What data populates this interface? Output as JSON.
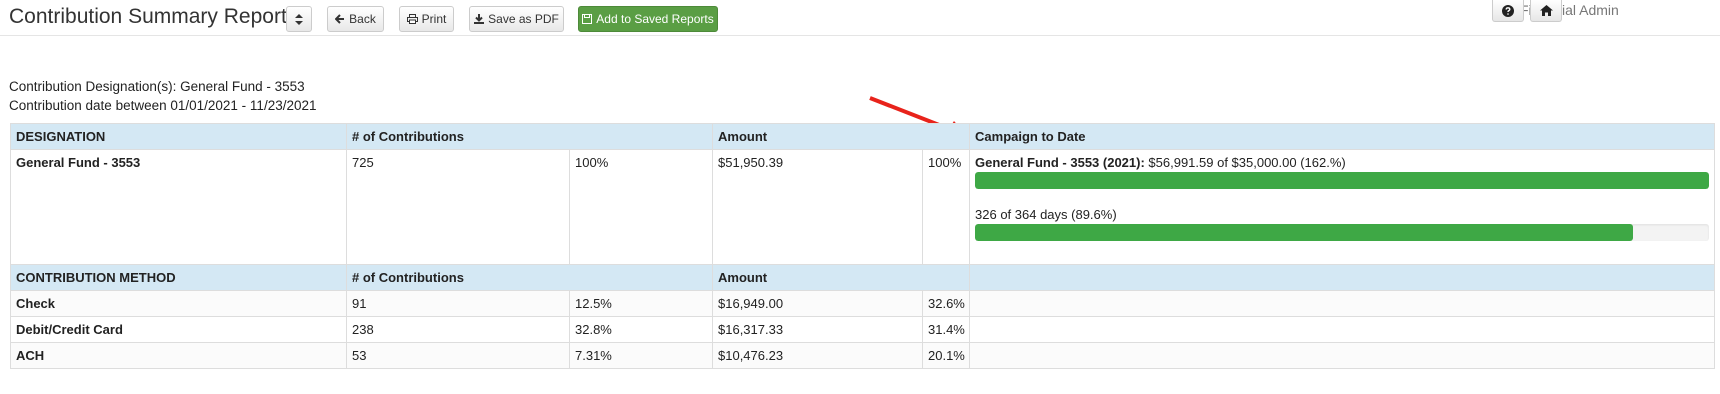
{
  "header": {
    "title": "Contribution Summary Report",
    "back_label": "Back",
    "print_label": "Print",
    "pdf_label": "Save as PDF",
    "saved_label": "Add to Saved Reports",
    "user": "Financial Admin"
  },
  "criteria": {
    "designation": "Contribution Designation(s): General Fund - 3553",
    "date_range": "Contribution date between 01/01/2021 - 11/23/2021"
  },
  "designation_table": {
    "headers": [
      "DESIGNATION",
      "# of Contributions",
      "Amount",
      "Campaign to Date"
    ],
    "row": {
      "name": "General Fund - 3553",
      "count": "725",
      "count_pct": "100%",
      "amount": "$51,950.39",
      "amount_pct": "100%",
      "campaign_name": "General Fund - 3553 (2021):",
      "campaign_text": " $56,991.59 of $35,000.00 (162.%)",
      "campaign_progress": 1.0,
      "days_text": "326 of 364 days (89.6%)",
      "days_progress": 0.896
    }
  },
  "method_table": {
    "headers": [
      "CONTRIBUTION METHOD",
      "# of Contributions",
      "Amount"
    ],
    "rows": [
      {
        "method": "Check",
        "count": "91",
        "count_pct": "12.5%",
        "amount": "$16,949.00",
        "amount_pct": "32.6%"
      },
      {
        "method": "Debit/Credit Card",
        "count": "238",
        "count_pct": "32.8%",
        "amount": "$16,317.33",
        "amount_pct": "31.4%"
      },
      {
        "method": "ACH",
        "count": "53",
        "count_pct": "7.31%",
        "amount": "$10,476.23",
        "amount_pct": "20.1%"
      }
    ]
  },
  "colors": {
    "header_bg": "#d4e8f4",
    "progress": "#3ea845",
    "save_button": "#5a9e44",
    "annotation_arrow": "#e8231b"
  }
}
